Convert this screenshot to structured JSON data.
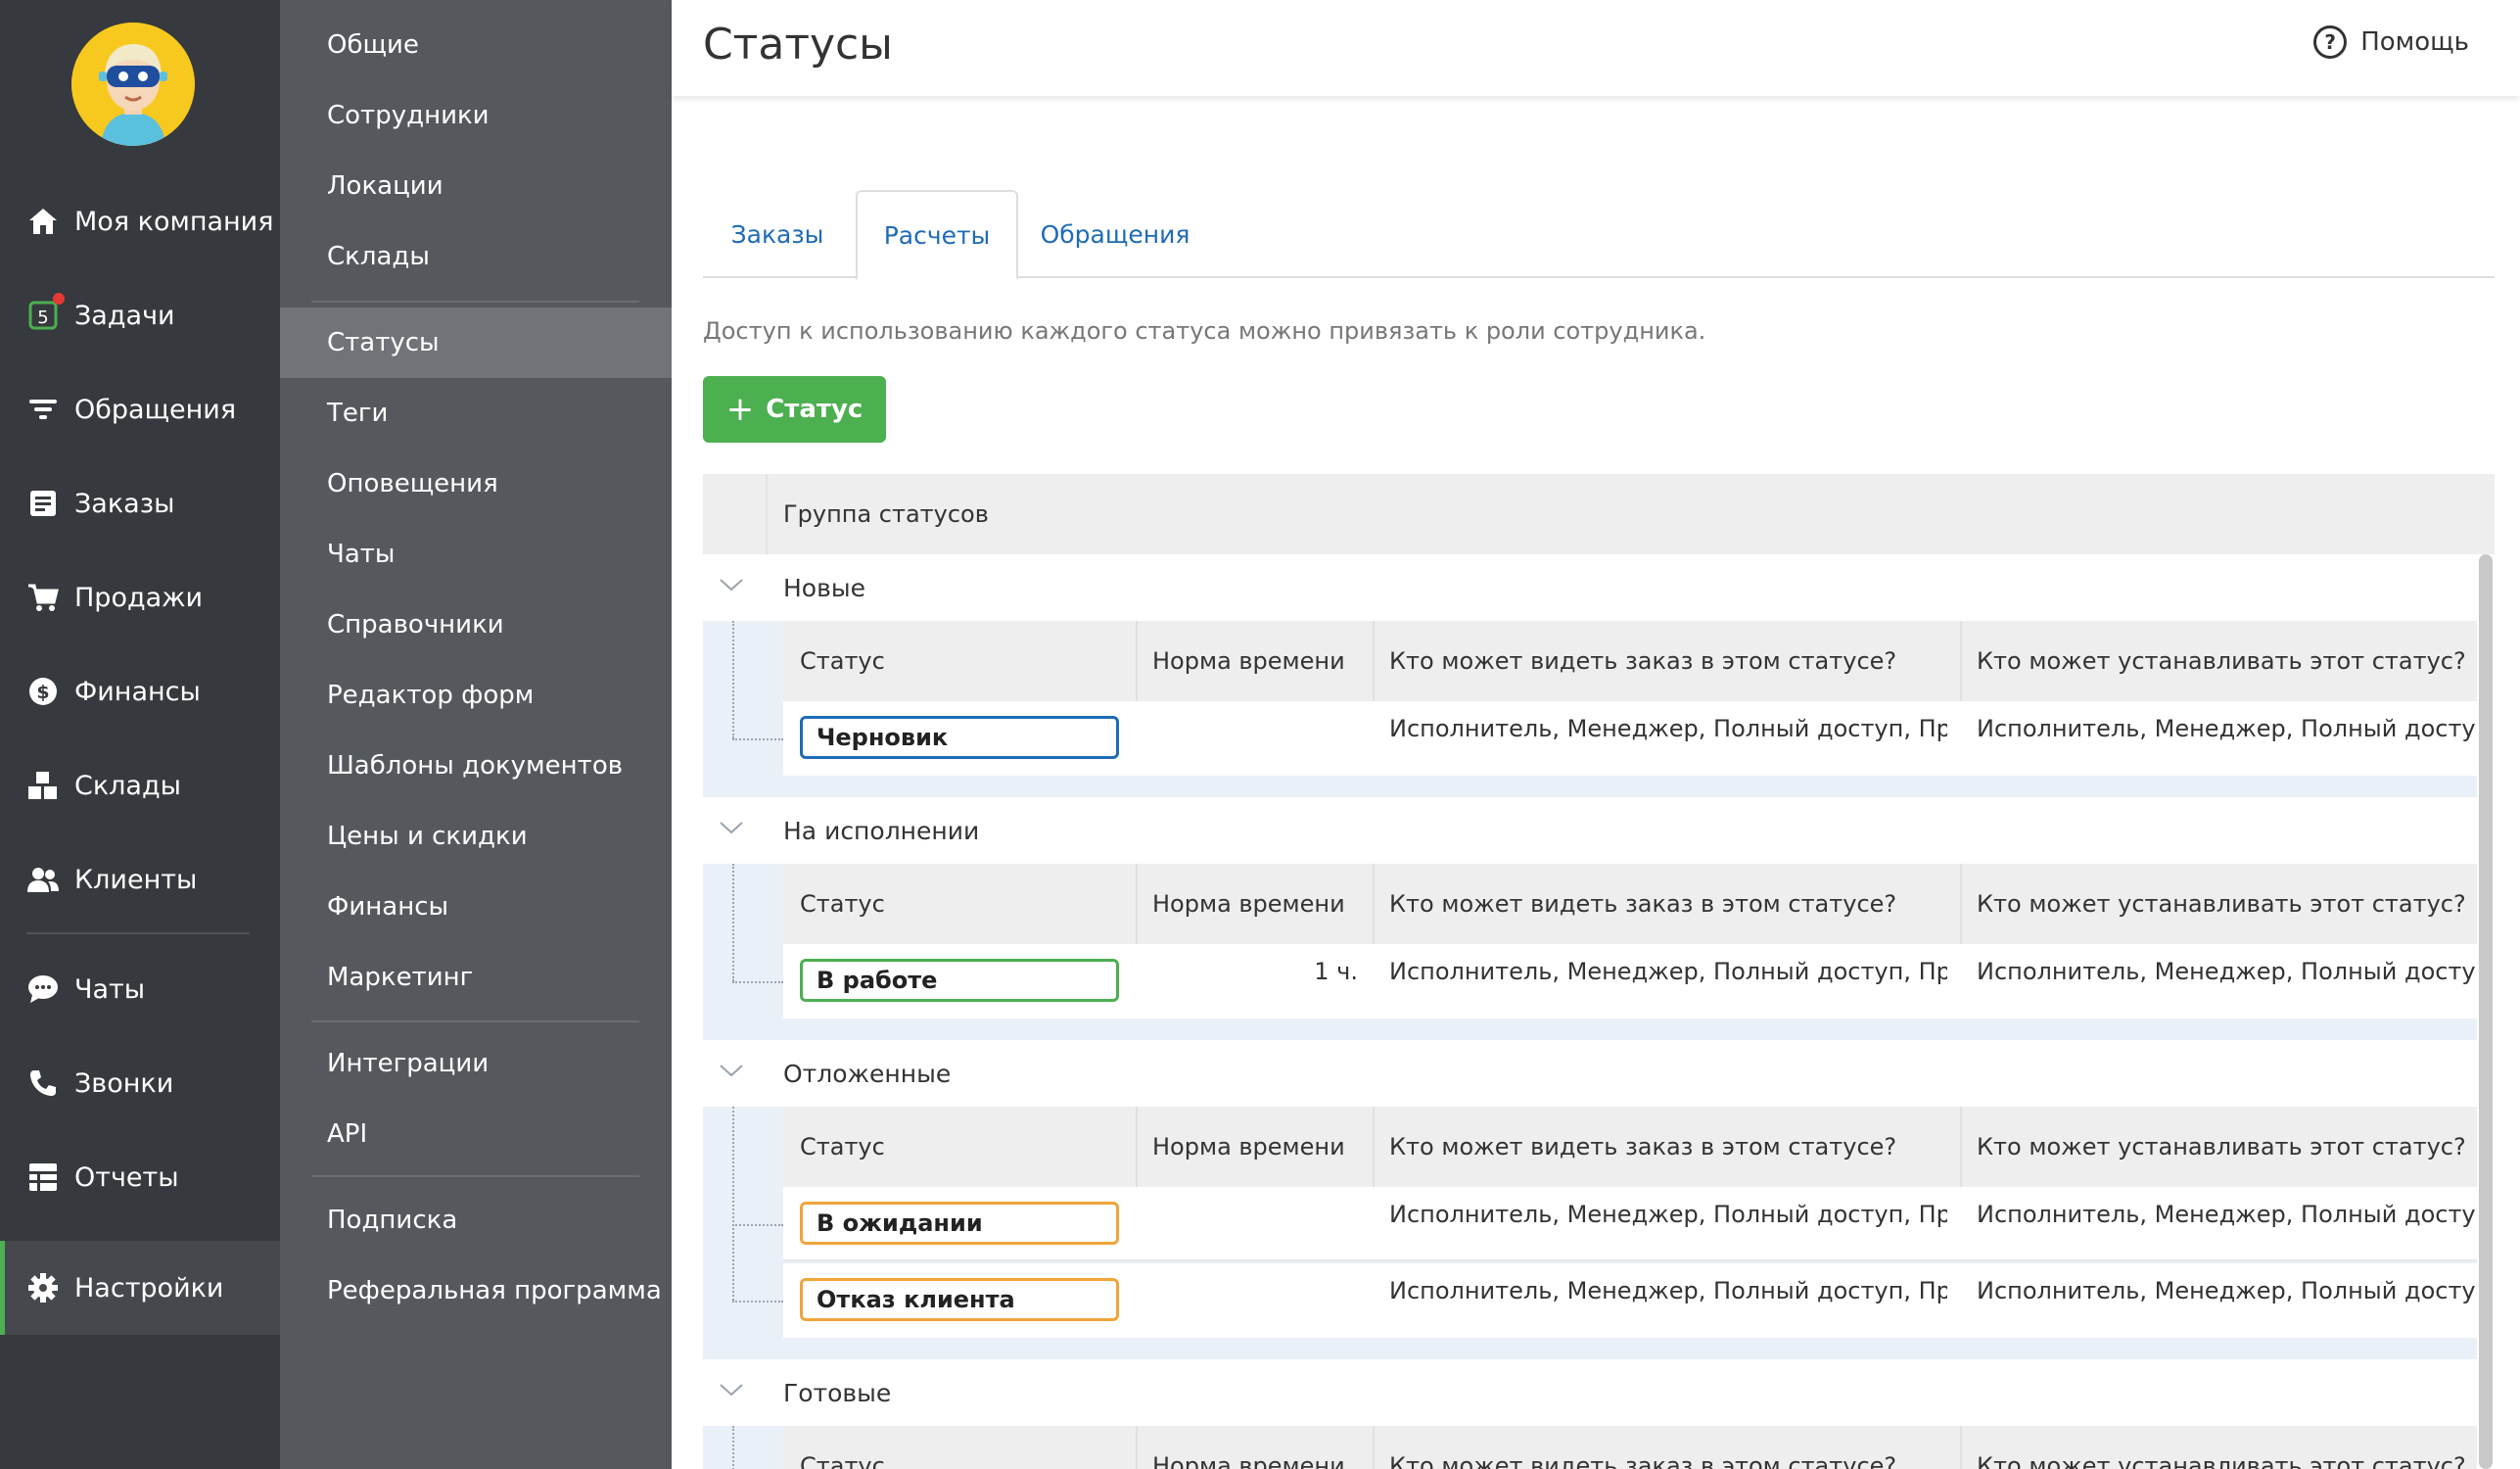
{
  "nav": {
    "items": [
      {
        "label": "Моя компания",
        "icon": "home-icon"
      },
      {
        "label": "Задачи",
        "icon": "tasks-icon",
        "badge": "5"
      },
      {
        "label": "Обращения",
        "icon": "filter-icon"
      },
      {
        "label": "Заказы",
        "icon": "orders-icon"
      },
      {
        "label": "Продажи",
        "icon": "cart-icon"
      },
      {
        "label": "Финансы",
        "icon": "dollar-icon"
      },
      {
        "label": "Склады",
        "icon": "boxes-icon"
      },
      {
        "label": "Клиенты",
        "icon": "clients-icon"
      },
      {
        "label": "Чаты",
        "icon": "chat-icon"
      },
      {
        "label": "Звонки",
        "icon": "phone-icon"
      },
      {
        "label": "Отчеты",
        "icon": "reports-icon"
      },
      {
        "label": "Настройки",
        "icon": "gear-icon",
        "active": true
      }
    ]
  },
  "submenu": {
    "items": [
      "Общие",
      "Сотрудники",
      "Локации",
      "Склады",
      "Статусы",
      "Теги",
      "Оповещения",
      "Чаты",
      "Справочники",
      "Редактор форм",
      "Шаблоны документов",
      "Цены и скидки",
      "Финансы",
      "Маркетинг",
      "Интеграции",
      "API",
      "Подписка",
      "Реферальная программа"
    ],
    "active": "Статусы"
  },
  "header": {
    "title": "Статусы",
    "help_label": "Помощь"
  },
  "tabs": [
    "Заказы",
    "Расчеты",
    "Обращения"
  ],
  "active_tab": "Расчеты",
  "hint": "Доступ к использованию каждого статуса можно привязать к роли сотрудника.",
  "add_button_label": "Статус",
  "table": {
    "group_header": "Группа статусов",
    "columns": {
      "status": "Статус",
      "norm": "Норма времени",
      "who_sees": "Кто может видеть заказ в этом статусе?",
      "who_sets": "Кто может устанавливать этот статус?"
    },
    "groups": [
      {
        "name": "Новые",
        "rows": [
          {
            "status": "Черновик",
            "color": "#1e6bb8",
            "norm": "",
            "sees": "Исполнитель,  Менеджер,  Полный доступ,  Пр...",
            "sets": "Исполнитель,  Менеджер,  Полный доступ,  П"
          }
        ]
      },
      {
        "name": "На исполнении",
        "rows": [
          {
            "status": "В работе",
            "color": "#4caf50",
            "norm": "1 ч.",
            "sees": "Исполнитель,  Менеджер,  Полный доступ,  Пр...",
            "sets": "Исполнитель,  Менеджер,  Полный доступ,  П"
          }
        ]
      },
      {
        "name": "Отложенные",
        "rows": [
          {
            "status": "В ожидании",
            "color": "#f0a43a",
            "norm": "",
            "sees": "Исполнитель,  Менеджер,  Полный доступ,  Пр...",
            "sets": "Исполнитель,  Менеджер,  Полный доступ,  П"
          },
          {
            "status": "Отказ клиента",
            "color": "#f0a43a",
            "norm": "",
            "sees": "Исполнитель,  Менеджер,  Полный доступ,  Пр...",
            "sets": "Исполнитель,  Менеджер,  Полный доступ,  П"
          }
        ]
      },
      {
        "name": "Готовые",
        "rows": []
      }
    ]
  }
}
